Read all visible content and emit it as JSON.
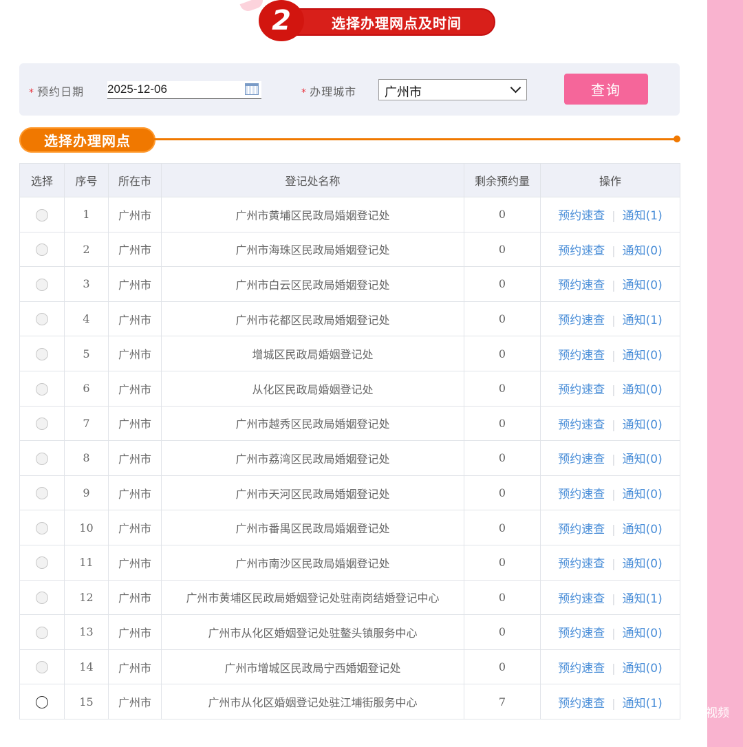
{
  "step": {
    "number": "2",
    "title": "选择办理网点及时间"
  },
  "search": {
    "required_mark": "*",
    "date_label": "预约日期",
    "date_value": "2025-12-06",
    "city_label": "办理城市",
    "city_value": "广州市",
    "query_label": "查询"
  },
  "section": {
    "title": "选择办理网点"
  },
  "table": {
    "headers": [
      "选择",
      "序号",
      "所在市",
      "登记处名称",
      "剩余预约量",
      "操作"
    ],
    "rows": [
      {
        "no": "1",
        "city": "广州市",
        "name": "广州市黄埔区民政局婚姻登记处",
        "remain": "0",
        "query": "预约速查",
        "notice": "通知(1)"
      },
      {
        "no": "2",
        "city": "广州市",
        "name": "广州市海珠区民政局婚姻登记处",
        "remain": "0",
        "query": "预约速查",
        "notice": "通知(0)"
      },
      {
        "no": "3",
        "city": "广州市",
        "name": "广州市白云区民政局婚姻登记处",
        "remain": "0",
        "query": "预约速查",
        "notice": "通知(0)"
      },
      {
        "no": "4",
        "city": "广州市",
        "name": "广州市花都区民政局婚姻登记处",
        "remain": "0",
        "query": "预约速查",
        "notice": "通知(1)"
      },
      {
        "no": "5",
        "city": "广州市",
        "name": "增城区民政局婚姻登记处",
        "remain": "0",
        "query": "预约速查",
        "notice": "通知(0)"
      },
      {
        "no": "6",
        "city": "广州市",
        "name": "从化区民政局婚姻登记处",
        "remain": "0",
        "query": "预约速查",
        "notice": "通知(0)"
      },
      {
        "no": "7",
        "city": "广州市",
        "name": "广州市越秀区民政局婚姻登记处",
        "remain": "0",
        "query": "预约速查",
        "notice": "通知(0)"
      },
      {
        "no": "8",
        "city": "广州市",
        "name": "广州市荔湾区民政局婚姻登记处",
        "remain": "0",
        "query": "预约速查",
        "notice": "通知(0)"
      },
      {
        "no": "9",
        "city": "广州市",
        "name": "广州市天河区民政局婚姻登记处",
        "remain": "0",
        "query": "预约速查",
        "notice": "通知(0)"
      },
      {
        "no": "10",
        "city": "广州市",
        "name": "广州市番禺区民政局婚姻登记处",
        "remain": "0",
        "query": "预约速查",
        "notice": "通知(0)"
      },
      {
        "no": "11",
        "city": "广州市",
        "name": "广州市南沙区民政局婚姻登记处",
        "remain": "0",
        "query": "预约速查",
        "notice": "通知(0)"
      },
      {
        "no": "12",
        "city": "广州市",
        "name": "广州市黄埔区民政局婚姻登记处驻南岗结婚登记中心",
        "remain": "0",
        "query": "预约速查",
        "notice": "通知(1)"
      },
      {
        "no": "13",
        "city": "广州市",
        "name": "广州市从化区婚姻登记处驻鳌头镇服务中心",
        "remain": "0",
        "query": "预约速查",
        "notice": "通知(0)"
      },
      {
        "no": "14",
        "city": "广州市",
        "name": "广州市增城区民政局宁西婚姻登记处",
        "remain": "0",
        "query": "预约速查",
        "notice": "通知(0)"
      },
      {
        "no": "15",
        "city": "广州市",
        "name": "广州市从化区婚姻登记处驻江埔街服务中心",
        "remain": "7",
        "query": "预约速查",
        "notice": "通知(1)"
      }
    ]
  },
  "watermark": "视频",
  "colors": {
    "accent_pink": "#f5669a",
    "banner_red": "#d81f1a",
    "section_orange": "#f07800",
    "remain_zero": "#e5323a",
    "link_blue": "#4a8ed8"
  }
}
